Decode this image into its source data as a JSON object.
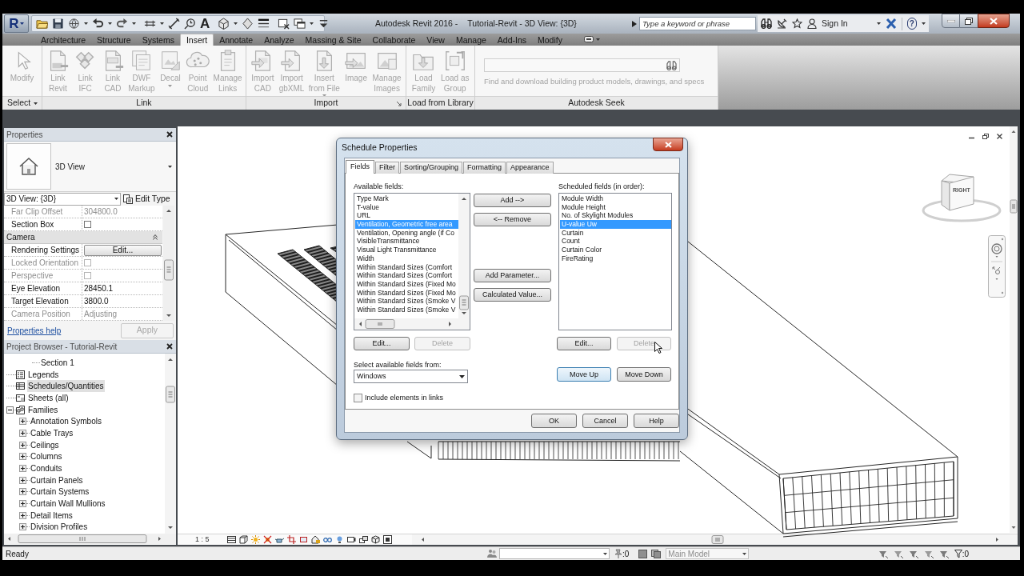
{
  "app_menu": {
    "glyph": "R"
  },
  "quick_access": {
    "text_tool_glyph": "A"
  },
  "title_bar": {
    "app_title": "Autodesk Revit 2016 -",
    "document_title": "Tutorial-Revit - 3D View: {3D}",
    "search": {
      "placeholder": "Type a keyword or phrase"
    },
    "sign_in": "Sign In",
    "help_glyph": "?"
  },
  "ribbon": {
    "tabs": [
      {
        "label": "Architecture",
        "selected": false
      },
      {
        "label": "Structure",
        "selected": false
      },
      {
        "label": "Systems",
        "selected": false
      },
      {
        "label": "Insert",
        "selected": true
      },
      {
        "label": "Annotate",
        "selected": false
      },
      {
        "label": "Analyze",
        "selected": false
      },
      {
        "label": "Massing & Site",
        "selected": false
      },
      {
        "label": "Collaborate",
        "selected": false
      },
      {
        "label": "View",
        "selected": false
      },
      {
        "label": "Manage",
        "selected": false
      },
      {
        "label": "Add-Ins",
        "selected": false
      },
      {
        "label": "Modify",
        "selected": false
      }
    ],
    "panels": [
      {
        "label": "Select",
        "label_menu": true,
        "launcher": false,
        "buttons": [
          {
            "label": "Modify",
            "kind": "button",
            "disabled": true
          }
        ]
      },
      {
        "label": "Link",
        "label_menu": false,
        "launcher": false,
        "buttons": [
          {
            "label": "Link\nRevit",
            "kind": "button",
            "disabled": true
          },
          {
            "label": "Link\nIFC",
            "kind": "button",
            "disabled": true
          },
          {
            "label": "Link\nCAD",
            "kind": "button",
            "disabled": true
          },
          {
            "label": "DWF\nMarkup",
            "kind": "button",
            "disabled": true
          },
          {
            "label": "Decal",
            "kind": "dropdown",
            "disabled": true
          },
          {
            "label": "Point\nCloud",
            "kind": "button",
            "disabled": true
          },
          {
            "label": "Manage\nLinks",
            "kind": "button",
            "disabled": true
          }
        ]
      },
      {
        "label": "Import",
        "label_menu": false,
        "launcher": true,
        "buttons": [
          {
            "label": "Import\nCAD",
            "kind": "button",
            "disabled": true
          },
          {
            "label": "Import\ngbXML",
            "kind": "button",
            "disabled": true
          },
          {
            "label": "Insert\nfrom File",
            "kind": "dropdown",
            "disabled": true
          },
          {
            "label": "Image",
            "kind": "button",
            "disabled": true
          },
          {
            "label": "Manage\nImages",
            "kind": "button",
            "disabled": true
          }
        ]
      },
      {
        "label": "Load from Library",
        "label_menu": false,
        "launcher": false,
        "buttons": [
          {
            "label": "Load\nFamily",
            "kind": "button",
            "disabled": true
          },
          {
            "label": "Load as\nGroup",
            "kind": "button",
            "disabled": true
          }
        ]
      }
    ],
    "seek": {
      "label": "Autodesk Seek",
      "hint": "Find and download building product models, drawings, and specs"
    }
  },
  "properties": {
    "title": "Properties",
    "type_name": "3D View",
    "instance": "3D View: {3D}",
    "edit_type": "Edit Type",
    "rows": [
      {
        "kind": "value",
        "label": "Far Clip Offset",
        "value": "304800.0",
        "disabled": true
      },
      {
        "kind": "checkbox",
        "label": "Section Box",
        "checked": false,
        "disabled": false
      },
      {
        "kind": "group",
        "label": "Camera",
        "expanded": true
      },
      {
        "kind": "button",
        "label": "Rendering Settings",
        "value": "Edit...",
        "disabled": false
      },
      {
        "kind": "checkbox",
        "label": "Locked Orientation",
        "checked": false,
        "disabled": true
      },
      {
        "kind": "checkbox",
        "label": "Perspective",
        "checked": false,
        "disabled": true
      },
      {
        "kind": "value",
        "label": "Eye Elevation",
        "value": "28450.1",
        "disabled": false
      },
      {
        "kind": "value",
        "label": "Target Elevation",
        "value": "3800.0",
        "disabled": false
      },
      {
        "kind": "value",
        "label": "Camera Position",
        "value": "Adjusting",
        "disabled": true
      }
    ],
    "help_link": "Properties help",
    "apply": {
      "label": "Apply",
      "disabled": true
    }
  },
  "project_browser": {
    "title": "Project Browser - Tutorial-Revit",
    "continued_items": [
      {
        "label": "Section 1",
        "selected": false
      }
    ],
    "items": [
      {
        "kind": "legend",
        "label": "Legends",
        "selected": false
      },
      {
        "kind": "schedule",
        "label": "Schedules/Quantities",
        "selected": true
      },
      {
        "kind": "sheet",
        "label": "Sheets (all)",
        "selected": false
      },
      {
        "kind": "family",
        "label": "Families",
        "selected": false,
        "expanded": true,
        "children": [
          {
            "label": "Annotation Symbols",
            "selected": false,
            "expanded": false
          },
          {
            "label": "Cable Trays",
            "selected": false,
            "expanded": false
          },
          {
            "label": "Ceilings",
            "selected": false,
            "expanded": false
          },
          {
            "label": "Columns",
            "selected": false,
            "expanded": false
          },
          {
            "label": "Conduits",
            "selected": false,
            "expanded": false
          },
          {
            "label": "Curtain Panels",
            "selected": false,
            "expanded": false
          },
          {
            "label": "Curtain Systems",
            "selected": false,
            "expanded": false
          },
          {
            "label": "Curtain Wall Mullions",
            "selected": false,
            "expanded": false
          },
          {
            "label": "Detail Items",
            "selected": false,
            "expanded": false
          },
          {
            "label": "Division Profiles",
            "selected": false,
            "expanded": false
          }
        ]
      }
    ]
  },
  "viewport": {
    "view_cube_face": "RIGHT",
    "scale": "1 : 5"
  },
  "dialog": {
    "title": "Schedule Properties",
    "tabs": [
      {
        "label": "Fields",
        "selected": true
      },
      {
        "label": "Filter",
        "selected": false
      },
      {
        "label": "Sorting/Grouping",
        "selected": false
      },
      {
        "label": "Formatting",
        "selected": false
      },
      {
        "label": "Appearance",
        "selected": false
      }
    ],
    "available_label": "Available fields:",
    "available_fields": [
      {
        "label": "Type Mark",
        "selected": false
      },
      {
        "label": "T-value",
        "selected": false
      },
      {
        "label": "URL",
        "selected": false
      },
      {
        "label": "Ventilation, Geometric free area",
        "selected": true
      },
      {
        "label": "Ventilation, Opening angle (if Co",
        "selected": false
      },
      {
        "label": "VisibleTransmittance",
        "selected": false
      },
      {
        "label": "Visual Light Transmittance",
        "selected": false
      },
      {
        "label": "Width",
        "selected": false
      },
      {
        "label": "Within Standard Sizes (Comfort",
        "selected": false
      },
      {
        "label": "Within Standard Sizes (Comfort",
        "selected": false
      },
      {
        "label": "Within Standard Sizes (Fixed Mo",
        "selected": false
      },
      {
        "label": "Within Standard Sizes (Fixed Mo",
        "selected": false
      },
      {
        "label": "Within Standard Sizes (Smoke V",
        "selected": false
      },
      {
        "label": "Within Standard Sizes (Smoke V",
        "selected": false
      }
    ],
    "add_button": "Add -->",
    "remove_button": "<-- Remove",
    "add_parameter_button": "Add Parameter...",
    "calculated_value_button": "Calculated Value...",
    "scheduled_label": "Scheduled fields (in order):",
    "scheduled_fields": [
      {
        "label": "Module Width",
        "selected": false
      },
      {
        "label": "Module Height",
        "selected": false
      },
      {
        "label": "No. of Skylight Modules",
        "selected": false
      },
      {
        "label": "U-value Uw",
        "selected": true
      },
      {
        "label": "Curtain",
        "selected": false
      },
      {
        "label": "Count",
        "selected": false
      },
      {
        "label": "Curtain Color",
        "selected": false
      },
      {
        "label": "FireRating",
        "selected": false
      }
    ],
    "available_buttons": [
      {
        "label": "Edit...",
        "disabled": false
      },
      {
        "label": "Delete",
        "disabled": true
      }
    ],
    "scheduled_buttons": [
      {
        "label": "Edit...",
        "disabled": false
      },
      {
        "label": "Delete",
        "disabled": true
      }
    ],
    "source": {
      "label": "Select available fields from:",
      "value": "Windows"
    },
    "move_buttons": [
      {
        "label": "Move Up",
        "focused": true
      },
      {
        "label": "Move Down",
        "focused": false
      }
    ],
    "include_links": {
      "label": "Include elements in links",
      "checked": false
    },
    "footer_buttons": [
      "OK",
      "Cancel",
      "Help"
    ]
  },
  "status_bar": {
    "message": "Ready",
    "left_counter": ":0",
    "design_option": {
      "value": "Main Model",
      "disabled": true
    },
    "filter_counter": ":0"
  }
}
